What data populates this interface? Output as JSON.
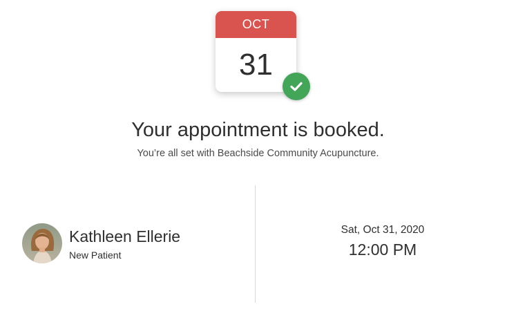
{
  "calendar": {
    "month": "OCT",
    "day": "31",
    "header_color": "#d9534f",
    "status_icon": "checkmark-icon",
    "status_color": "#43a558"
  },
  "confirmation": {
    "title": "Your appointment is booked.",
    "subtitle": "You’re all set with Beachside Community Acupuncture."
  },
  "patient": {
    "name": "Kathleen Ellerie",
    "status": "New Patient",
    "avatar_icon": "patient-avatar"
  },
  "appointment": {
    "date": "Sat, Oct 31, 2020",
    "time": "12:00 PM"
  }
}
